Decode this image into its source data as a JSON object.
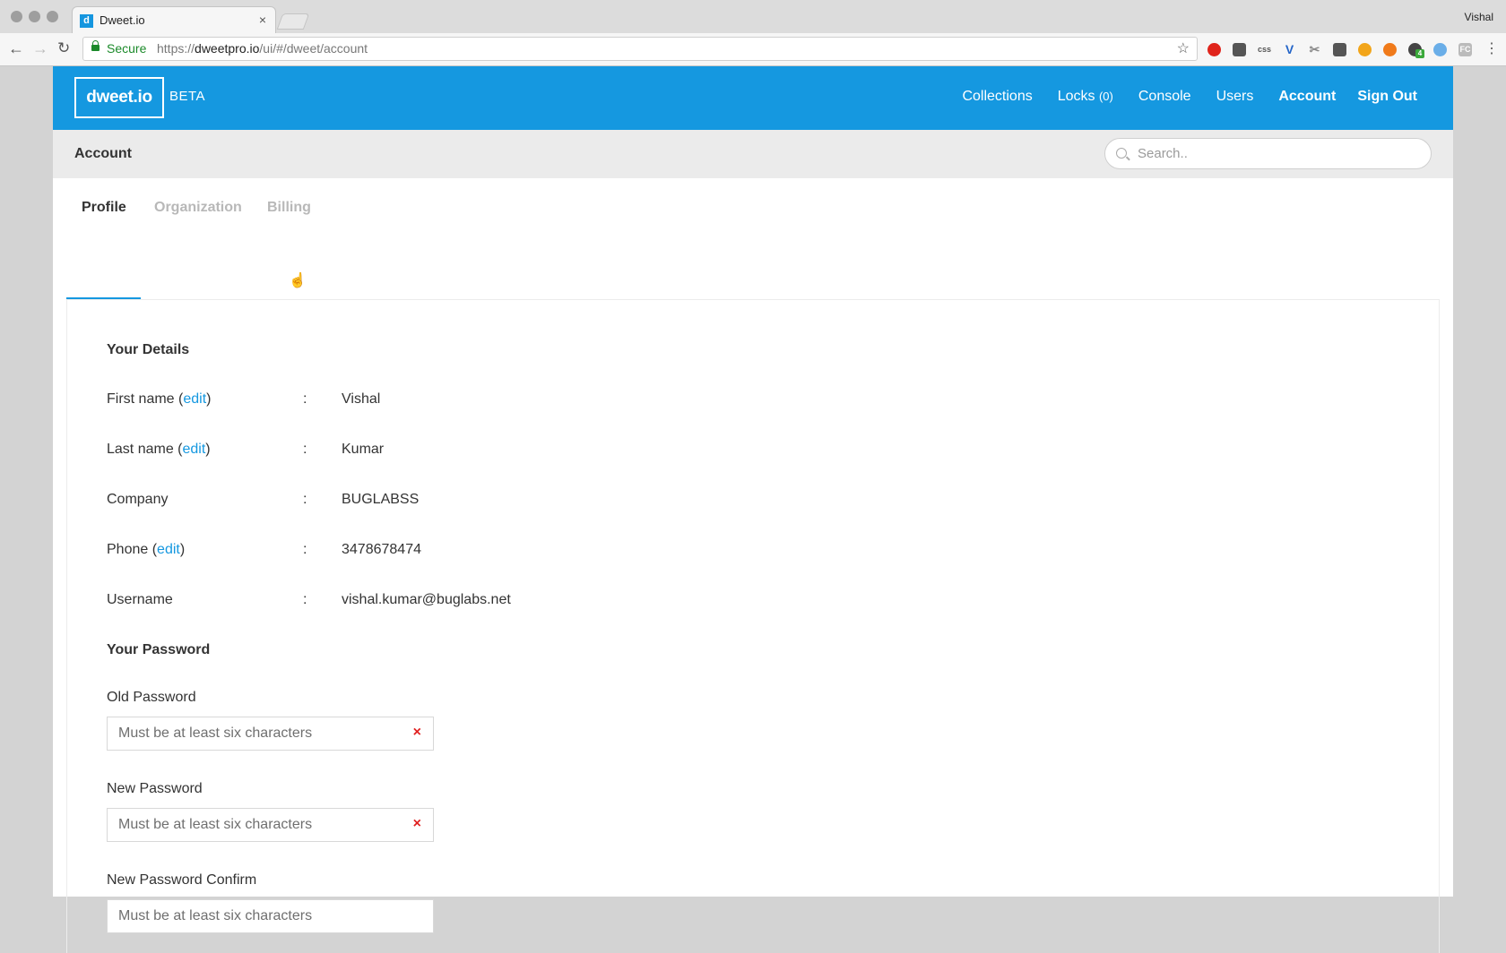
{
  "browser": {
    "tab_title": "Dweet.io",
    "tab_favicon_letter": "d",
    "tab_close": "×",
    "profile_name": "Vishal",
    "secure_label": "Secure",
    "url_protocol": "https://",
    "url_host": "dweetpro.io",
    "url_path": "/ui/#/dweet/account",
    "extensions": [
      "opera-icon",
      "pocket-icon",
      "css-icon",
      "vue-icon",
      "scissors-icon",
      "mail-icon",
      "chrome-extension-icon",
      "fire-icon",
      "ghostery-icon",
      "twitter-icon",
      "fc-icon"
    ],
    "ext_css_text": "css",
    "ext_fc_text": "FC",
    "ext_badge": "4"
  },
  "app": {
    "logo": "dweet.io",
    "beta": "BETA",
    "nav": {
      "collections": "Collections",
      "locks": "Locks",
      "locks_count": "(0)",
      "console": "Console",
      "users": "Users",
      "account": "Account",
      "signout": "Sign Out"
    },
    "subbar_title": "Account",
    "search_placeholder": "Search..",
    "tabs": {
      "profile": "Profile",
      "organization": "Organization",
      "billing": "Billing"
    }
  },
  "profile": {
    "details_title": "Your Details",
    "edit_label": "edit",
    "colon": ":",
    "first_name_label": "First name",
    "first_name": "Vishal",
    "last_name_label": "Last name",
    "last_name": "Kumar",
    "company_label": "Company",
    "company": "BUGLABSS",
    "phone_label": "Phone",
    "phone": "3478678474",
    "username_label": "Username",
    "username": "vishal.kumar@buglabs.net",
    "password_title": "Your Password",
    "old_password_label": "Old Password",
    "new_password_label": "New Password",
    "confirm_password_label": "New Password Confirm",
    "password_placeholder": "Must be at least six characters",
    "error_mark": "×"
  }
}
